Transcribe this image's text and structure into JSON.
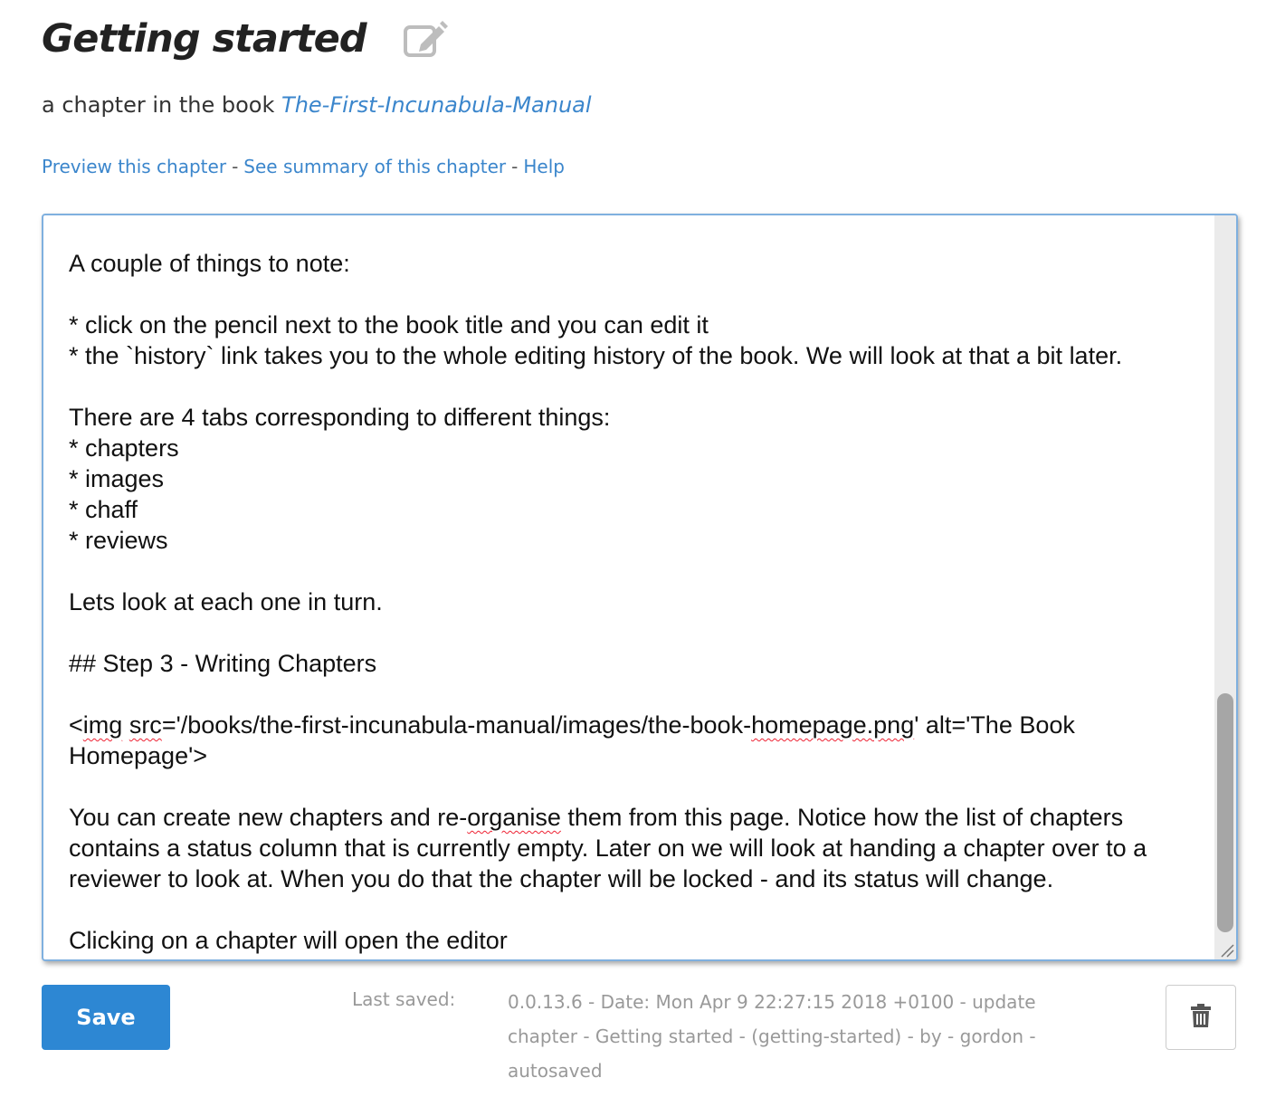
{
  "chapter": {
    "title": "Getting started",
    "subtitle_prefix": "a chapter in the book",
    "book_link": "The-First-Incunabula-Manual"
  },
  "links": {
    "preview": "Preview this chapter",
    "summary": "See summary of this chapter",
    "help": "Help",
    "separator": "-"
  },
  "editor": {
    "lines": {
      "l1": "A couple of things to note:",
      "l2": "* click on the pencil next to the book title and you can edit it",
      "l3": "* the `history` link takes you to the whole editing history of the book. We will look at that a bit later.",
      "l4": "There are 4 tabs corresponding to different things:",
      "l5": "* chapters",
      "l6": "* images",
      "l7": "* chaff",
      "l8": "* reviews",
      "l9": "Lets look at each one in turn.",
      "l10": "## Step 3 - Writing Chapters",
      "l11_a": "<",
      "l11_b": "img",
      "l11_c": " ",
      "l11_d": "src",
      "l11_e": "='/books/the-first-incunabula-manual/images/the-book-",
      "l11_f": "homepage.png",
      "l11_g": "' alt='The Book Homepage'>",
      "l12_a": "You can create new chapters and re-",
      "l12_b": "organise",
      "l12_c": " them from this page. Notice how the list of chapters contains a status column that is currently empty. Later on we will look at handing a chapter over to a reviewer to look at. When you do that the chapter will be locked - and its status will change.",
      "l13": "Clicking on a chapter will open the editor"
    }
  },
  "footer": {
    "save_label": "Save",
    "last_saved_label": "Last saved:",
    "last_saved_info": "0.0.13.6 - Date: Mon Apr 9 22:27:15 2018 +0100 - update chapter - Getting started - (getting-started) - by - gordon - autosaved"
  },
  "icons": {
    "edit": "pencil-edit-icon",
    "delete": "trash-icon"
  }
}
